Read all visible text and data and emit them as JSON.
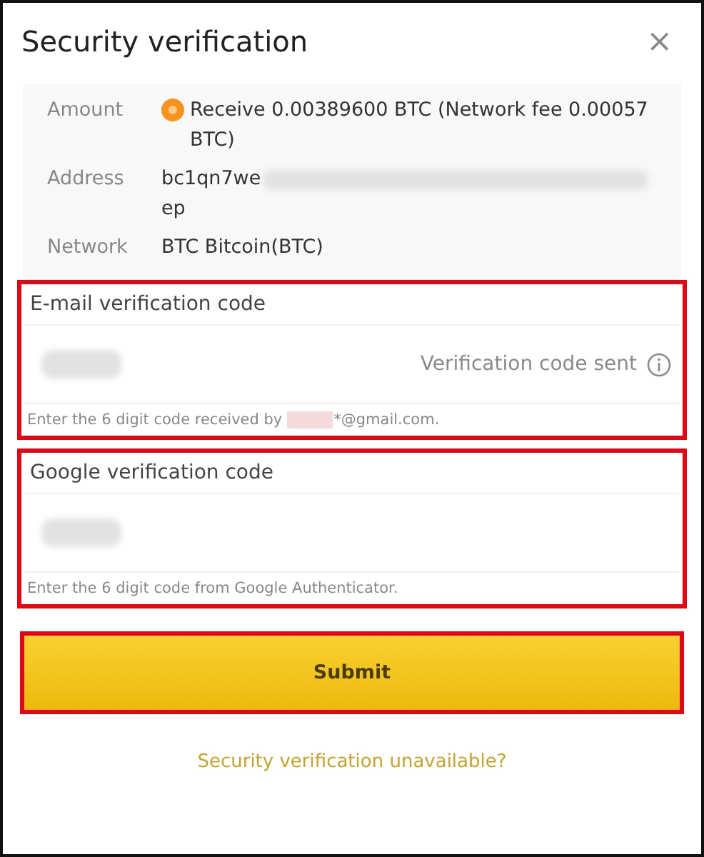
{
  "dialog": {
    "title": "Security verification",
    "close": "×"
  },
  "details": [
    {
      "label": "Amount",
      "value": "Receive 0.00389600 BTC (Network fee 0.00057 BTC)",
      "kind": "coin"
    },
    {
      "label": "Address",
      "value": "bc1qn7we",
      "value_end": "ep",
      "kind": "redacted"
    },
    {
      "label": "Network",
      "value": "BTC Bitcoin(BTC)",
      "kind": "plain"
    }
  ],
  "sections": [
    {
      "title": "E-mail verification code",
      "status": "Verification code sent",
      "hint": "Enter the 6 digit code received by",
      "hint_end": "*@gmail.com.",
      "kind": "email"
    },
    {
      "title": "Google verification code",
      "hint": "Enter the 6 digit code from Google Authenticator.",
      "kind": "google"
    }
  ],
  "submit": "Submit",
  "link": "Security verification unavailable?"
}
